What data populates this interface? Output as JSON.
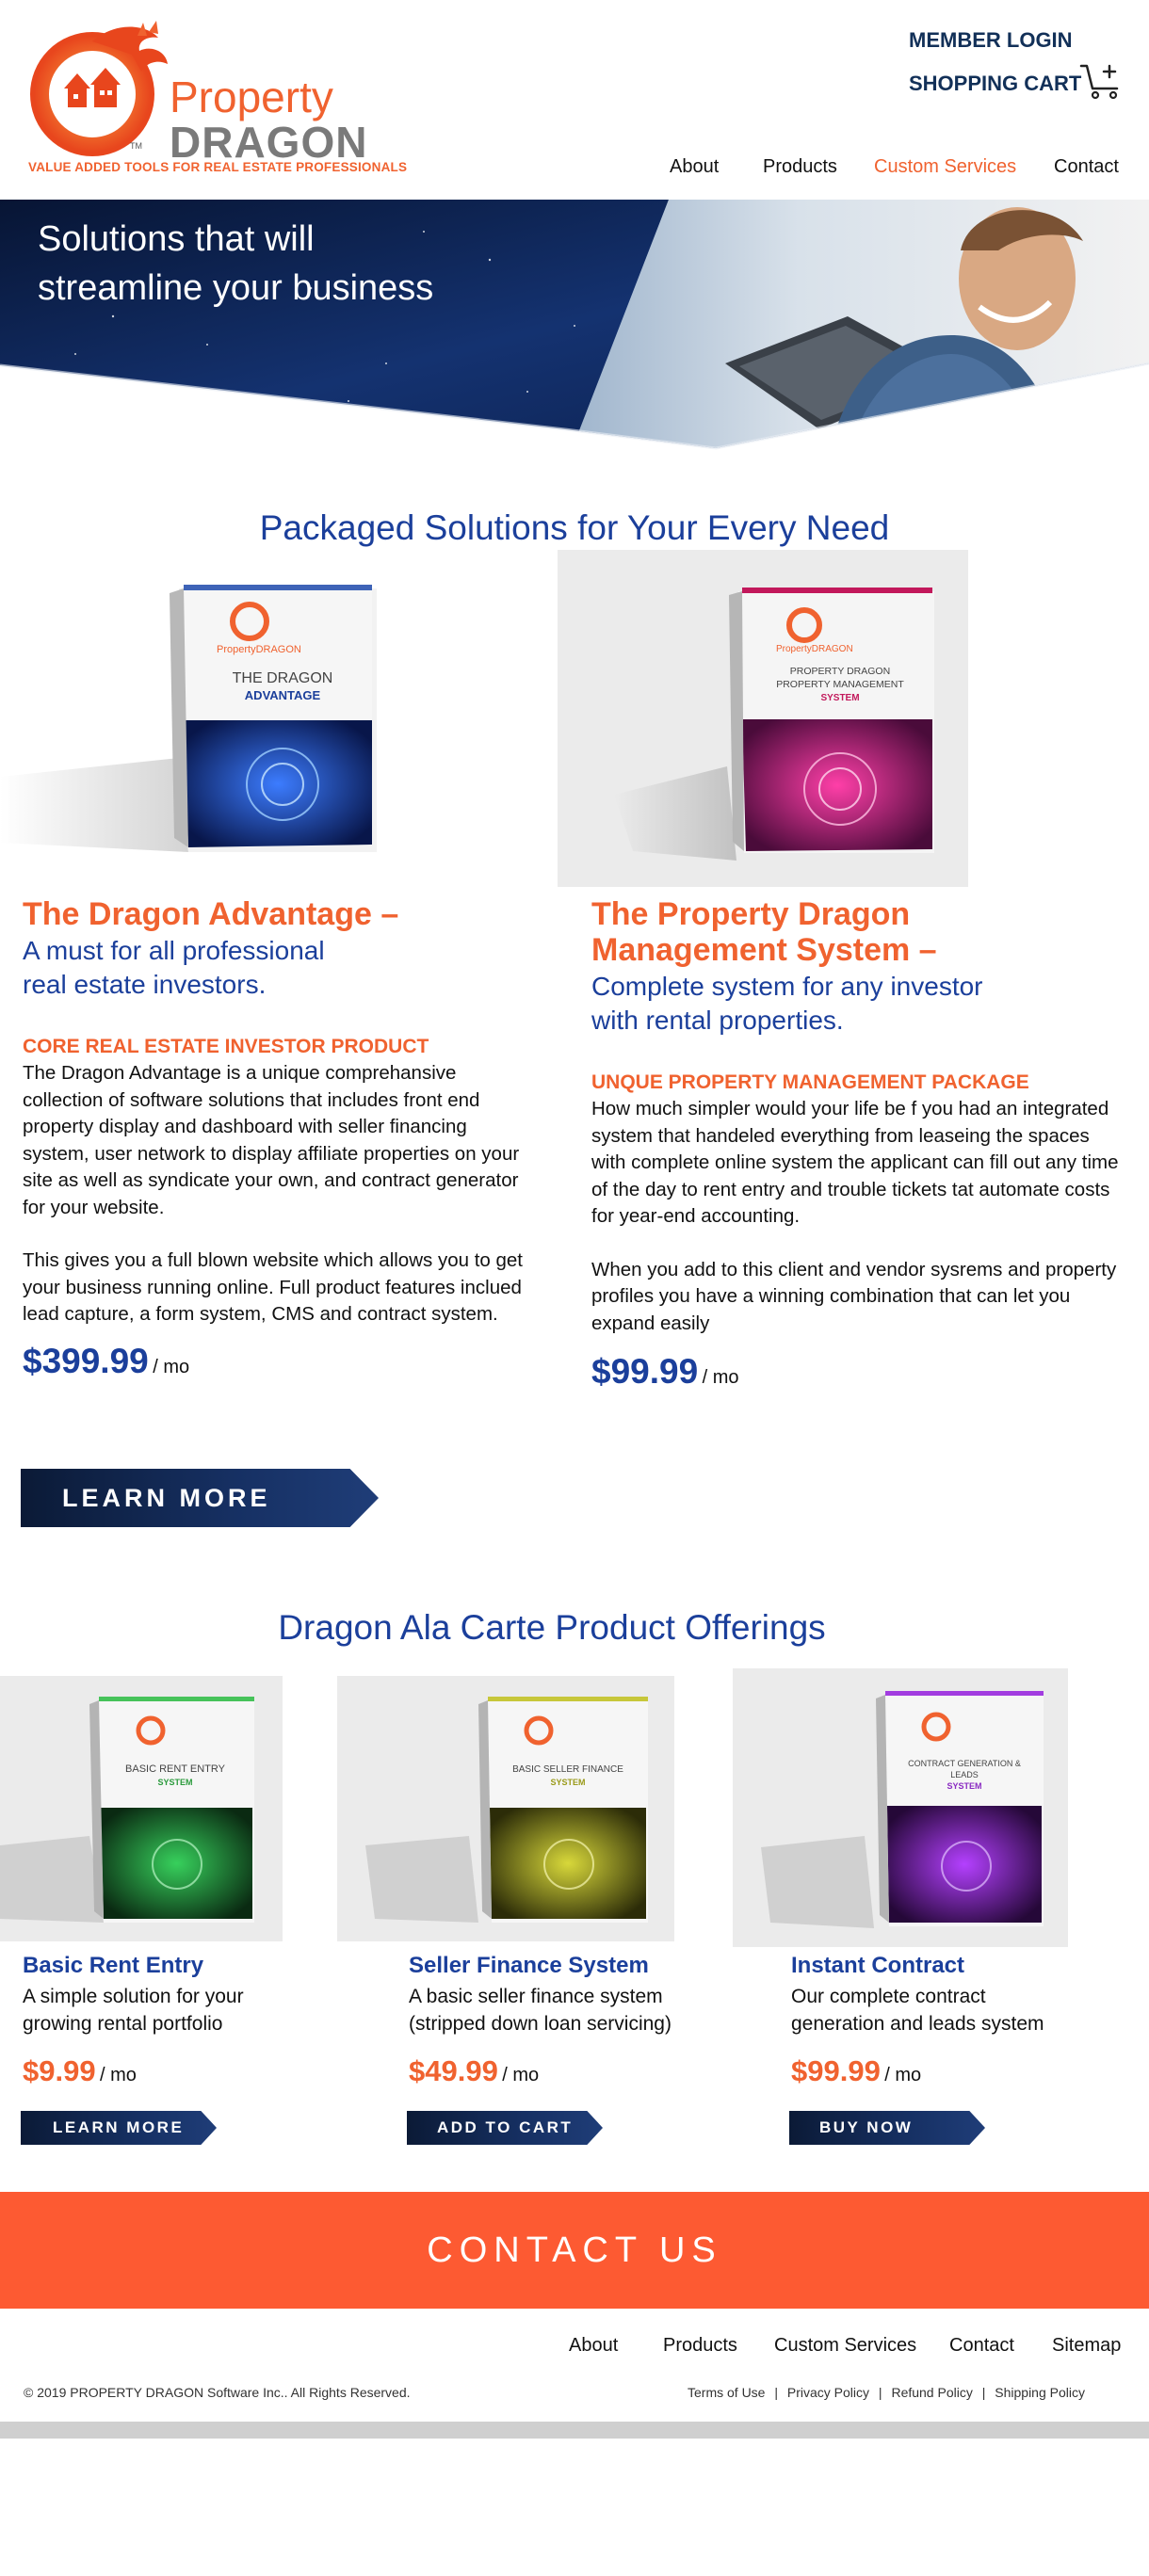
{
  "brand": {
    "name_line1": "Property",
    "name_line2": "DRAGON",
    "tagline": "VALUE ADDED TOOLS FOR REAL ESTATE PROFESSIONALS",
    "colors": {
      "orange": "#f0622f",
      "navy": "#1b3f9b",
      "dark_navy": "#123058",
      "contact_orange": "#fd5a32"
    }
  },
  "header": {
    "member_login": "MEMBER LOGIN",
    "shopping_cart": "SHOPPING CART",
    "cart_icon": "cart-plus-icon",
    "nav": [
      {
        "label": "About"
      },
      {
        "label": "Products"
      },
      {
        "label": "Custom Services",
        "active": true
      },
      {
        "label": "Contact"
      }
    ]
  },
  "hero": {
    "title_line1": "Solutions that will",
    "title_line2": "streamline your business"
  },
  "packaged": {
    "heading": "Packaged Solutions for Your Every Need",
    "products": [
      {
        "box_brand": "PropertyDRAGON",
        "box_line1": "THE DRAGON",
        "box_line2": "ADVANTAGE",
        "title": "The Dragon Advantage –",
        "subtitle_line1": "A must for all professional",
        "subtitle_line2": "real estate investors.",
        "kicker": "CORE REAL ESTATE INVESTOR PRODUCT",
        "body1": "The Dragon Advantage is a unique comprehansive collection of software solutions that includes front end property display and dashboard with seller financing system, user network to display affiliate properties on your site as well as syndicate your own, and contract generator for your website.",
        "body2": "This gives you a full blown website which allows you to get your business running online. Full product features inclued lead capture, a form system, CMS and contract system.",
        "price": "$399.99",
        "per": "/ mo",
        "button": "LEARN MORE"
      },
      {
        "box_brand": "PropertyDRAGON",
        "box_line1": "PROPERTY DRAGON PROPERTY MANAGEMENT",
        "box_line2": "SYSTEM",
        "title_line1": "The Property Dragon",
        "title_line2": "Management System –",
        "subtitle_line1": "Complete system for any investor",
        "subtitle_line2": "with rental properties.",
        "kicker": "UNQUE PROPERTY MANAGEMENT PACKAGE",
        "body1": "How much simpler would your life be f you had an integrated system that handeled everything from leaseing the spaces with complete online system the applicant can fill out any time of the day to rent entry and trouble tickets tat automate costs for year-end accounting.",
        "body2": "When you add to this client and vendor sysrems and property profiles you have a winning combination that can let you expand easily",
        "price": "$99.99",
        "per": "/ mo"
      }
    ]
  },
  "ala_carte": {
    "heading": "Dragon Ala Carte Product Offerings",
    "items": [
      {
        "box_line1": "BASIC RENT ENTRY",
        "box_line2": "SYSTEM",
        "title": "Basic Rent Entry",
        "desc_line1": "A simple solution for your",
        "desc_line2": "growing rental portfolio",
        "price": "$9.99",
        "per": "/ mo",
        "button": "LEARN MORE"
      },
      {
        "box_line1": "BASIC SELLER FINANCE",
        "box_line2": "SYSTEM",
        "title": "Seller Finance System",
        "desc_line1": "A basic seller finance system",
        "desc_line2": "(stripped down loan servicing)",
        "price": "$49.99",
        "per": "/ mo",
        "button": "ADD TO CART"
      },
      {
        "box_line1": "CONTRACT GENERATION & LEADS",
        "box_line2": "SYSTEM",
        "title": "Instant Contract",
        "desc_line1": "Our complete contract",
        "desc_line2": "generation and leads system",
        "price": "$99.99",
        "per": "/ mo",
        "button": "BUY NOW"
      }
    ]
  },
  "contact": {
    "label": "CONTACT US"
  },
  "footer": {
    "nav": [
      {
        "label": "About"
      },
      {
        "label": "Products"
      },
      {
        "label": "Custom Services"
      },
      {
        "label": "Contact"
      },
      {
        "label": "Sitemap"
      }
    ],
    "copyright": "© 2019 PROPERTY DRAGON Software Inc.. All Rights Reserved.",
    "legal": [
      {
        "label": "Terms of Use"
      },
      {
        "label": "Privacy Policy"
      },
      {
        "label": "Refund Policy"
      },
      {
        "label": "Shipping Policy"
      }
    ],
    "separator": "|"
  }
}
